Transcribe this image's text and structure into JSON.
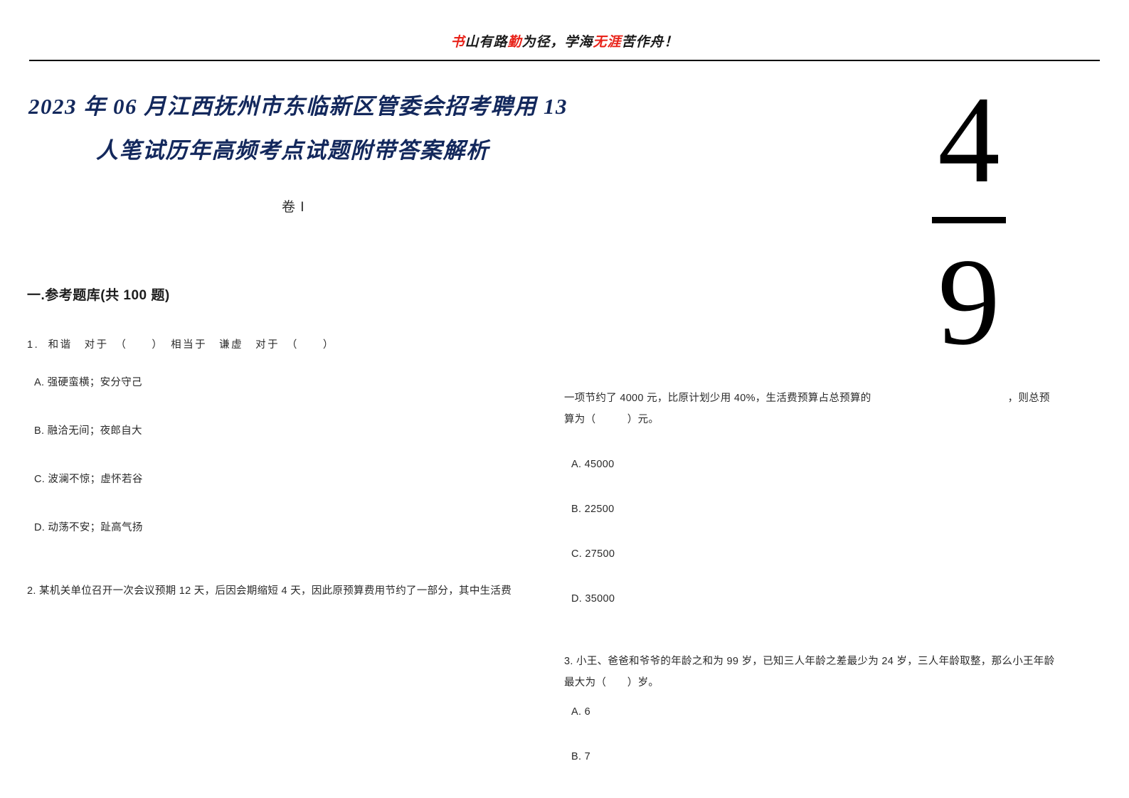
{
  "header": {
    "motto_segments": [
      {
        "text": "书",
        "color": "#e8231a"
      },
      {
        "text": "山有路",
        "color": "#1a1a1a"
      },
      {
        "text": "勤",
        "color": "#e8231a"
      },
      {
        "text": "为径，",
        "color": "#1a1a1a"
      },
      {
        "text": "学海",
        "color": "#1a1a1a"
      },
      {
        "text": "无涯",
        "color": "#e8231a"
      },
      {
        "text": "苦作舟！",
        "color": "#1a1a1a"
      }
    ],
    "motto_part1_red": "书",
    "motto_part2_black": "山有路",
    "motto_part3_red": "勤",
    "motto_part4_black": "为径，",
    "motto_part5_black": "学海",
    "motto_part6_red": "无涯",
    "motto_part7_black": "苦作舟！"
  },
  "title": {
    "line1": "2023 年 06 月江西抚州市东临新区管委会招考聘用 13",
    "line2": "人笔试历年高频考点试题附带答案解析",
    "color": "#13285c"
  },
  "page_fraction": {
    "numerator": "4",
    "denominator": "9"
  },
  "volume_label": "卷 I",
  "section_heading": "一.参考题库(共 100 题)",
  "questions": [
    {
      "number": "1.",
      "stem": "1. 和谐　对于　（　　）　相当于　谦虚　对于　（　　）",
      "options": [
        "A. 强硬蛮横；安分守己",
        "B. 融洽无间；夜郎自大",
        "C. 波澜不惊；虚怀若谷",
        "D. 动荡不安；趾高气扬"
      ]
    },
    {
      "number": "2.",
      "stem_line1": "2. 某机关单位召开一次会议预期 12 天，后因会期缩短 4 天，因此原预算费用节约了一部分，其中生活费",
      "stem_line2_a": "一项节约了 4000 元，比原计划少用 40%，生活费预算占总预算的",
      "stem_line2_b": "，则总预",
      "stem_line3": "算为（　　　）元。",
      "options": [
        "A. 45000",
        "B. 22500",
        "C. 27500",
        "D. 35000"
      ]
    },
    {
      "number": "3.",
      "stem_line1": "3. 小王、爸爸和爷爷的年龄之和为 99 岁，已知三人年龄之差最少为 24 岁，三人年龄取整，那么小王年龄",
      "stem_line2": "最大为（　　）岁。",
      "options": [
        "A. 6",
        "B. 7"
      ]
    }
  ]
}
